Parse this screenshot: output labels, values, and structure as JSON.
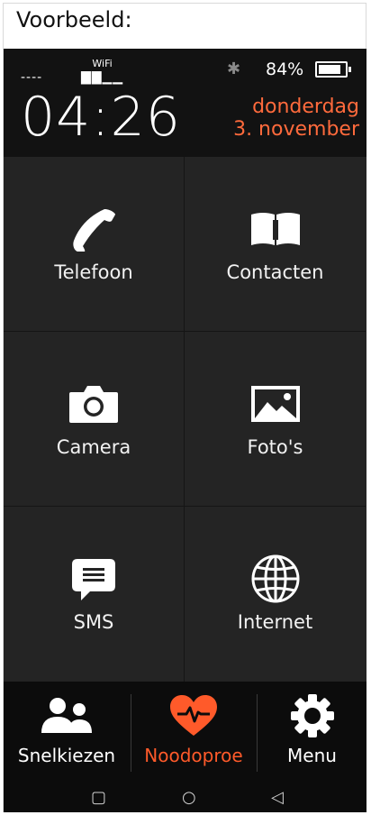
{
  "caption": "Voorbeeld:",
  "status": {
    "signal": "----",
    "wifi_label": "WiFi",
    "wifi_bars": "▇▇▁▁",
    "bluetooth": "✱",
    "battery_pct": "84%",
    "battery_level": 0.84,
    "time": "04:26",
    "date_line1": "donderdag",
    "date_line2": "3. november",
    "accent_color": "#ff6a3c"
  },
  "tiles": [
    {
      "label": "Telefoon",
      "icon": "phone-icon"
    },
    {
      "label": "Contacten",
      "icon": "book-icon"
    },
    {
      "label": "Camera",
      "icon": "camera-icon"
    },
    {
      "label": "Foto's",
      "icon": "photos-icon"
    },
    {
      "label": "SMS",
      "icon": "message-icon"
    },
    {
      "label": "Internet",
      "icon": "globe-icon"
    }
  ],
  "nav": {
    "speed_dial": "Snelkiezen",
    "emergency": "Noodoproe",
    "menu": "Menu"
  },
  "system": {
    "recent": "▢",
    "home": "○",
    "back": "◁"
  }
}
